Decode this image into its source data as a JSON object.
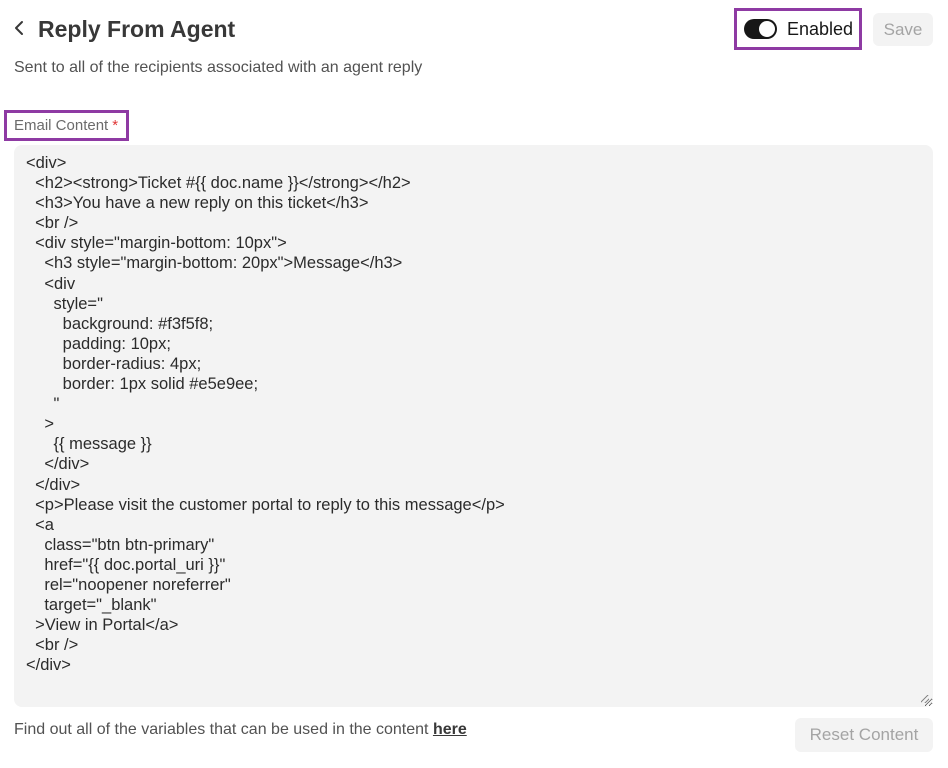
{
  "header": {
    "back_icon": "chevron-left-icon",
    "title": "Reply From Agent",
    "subtitle": "Sent to all of the recipients associated with an agent reply"
  },
  "toggle": {
    "label": "Enabled",
    "checked": true
  },
  "save_label": "Save",
  "field": {
    "label": "Email Content",
    "required_mark": "*"
  },
  "email_content": "<div>\n  <h2><strong>Ticket #{{ doc.name }}</strong></h2>\n  <h3>You have a new reply on this ticket</h3>\n  <br />\n  <div style=\"margin-bottom: 10px\">\n    <h3 style=\"margin-bottom: 20px\">Message</h3>\n    <div\n      style=\"\n        background: #f3f5f8;\n        padding: 10px;\n        border-radius: 4px;\n        border: 1px solid #e5e9ee;\n      \"\n    >\n      {{ message }}\n    </div>\n  </div>\n  <p>Please visit the customer portal to reply to this message</p>\n  <a\n    class=\"btn btn-primary\"\n    href=\"{{ doc.portal_uri }}\"\n    rel=\"noopener noreferrer\"\n    target=\"_blank\"\n  >View in Portal</a>\n  <br />\n</div>",
  "footer": {
    "help_text": "Find out all of the variables that can be used in the content ",
    "help_link": "here",
    "reset_label": "Reset Content"
  },
  "colors": {
    "highlight_border": "#8e3aa3",
    "editor_bg": "#f3f3f3",
    "required": "#e03636",
    "toggle_on": "#171717"
  }
}
